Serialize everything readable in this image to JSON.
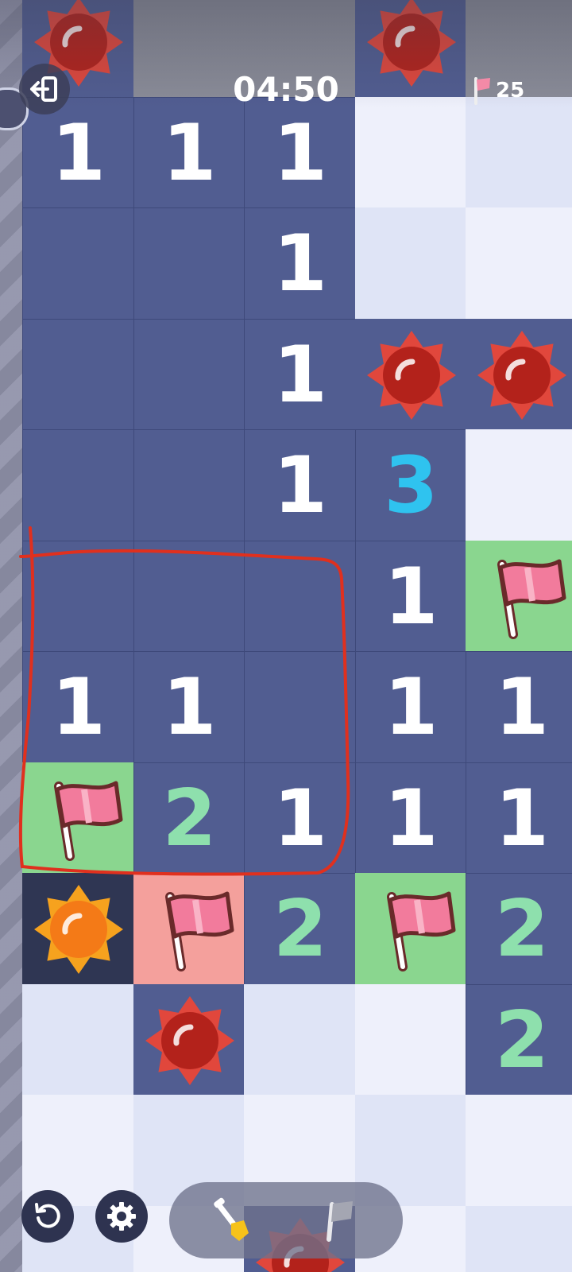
{
  "header": {
    "timer": "04:50",
    "flags_remaining": "25",
    "exit_icon": "exit-icon",
    "flag_icon": "flag-icon"
  },
  "board": {
    "columns": 5,
    "rows": [
      [
        "mine",
        "hidden-dark",
        "hidden-dark",
        "mine",
        "hidden-dark"
      ],
      [
        "1",
        "1",
        "1",
        "hidden",
        "hidden"
      ],
      [
        "empty",
        "empty",
        "1",
        "hidden",
        "hidden"
      ],
      [
        "empty",
        "empty",
        "1",
        "mine",
        "mine"
      ],
      [
        "empty",
        "empty",
        "1",
        "3",
        "hidden"
      ],
      [
        "empty",
        "empty",
        "empty",
        "1",
        "flag"
      ],
      [
        "1",
        "1",
        "empty",
        "1",
        "1"
      ],
      [
        "flag",
        "2",
        "1",
        "1",
        "1"
      ],
      [
        "mine-hit",
        "flag-wrong",
        "2",
        "flag",
        "2"
      ],
      [
        "hidden",
        "mine",
        "hidden",
        "hidden",
        "2"
      ],
      [
        "hidden",
        "hidden",
        "hidden",
        "hidden",
        "hidden"
      ],
      [
        "hidden",
        "hidden",
        "mine",
        "hidden",
        "hidden"
      ]
    ]
  },
  "toolbar": {
    "restart_icon": "restart-icon",
    "settings_icon": "settings-icon",
    "dig_icon": "shovel-icon",
    "flag_mode_icon": "flag-icon"
  },
  "colors": {
    "revealed": "#515d91",
    "hidden_light": "#eef0fb",
    "hidden_mid": "#dfe4f6",
    "correct_flag": "#8ad68f",
    "wrong_flag": "#f4a09c",
    "number_1": "#ffffff",
    "number_2": "#8ee0ad",
    "number_3": "#2fc3ef",
    "annotation": "#e0301e"
  }
}
